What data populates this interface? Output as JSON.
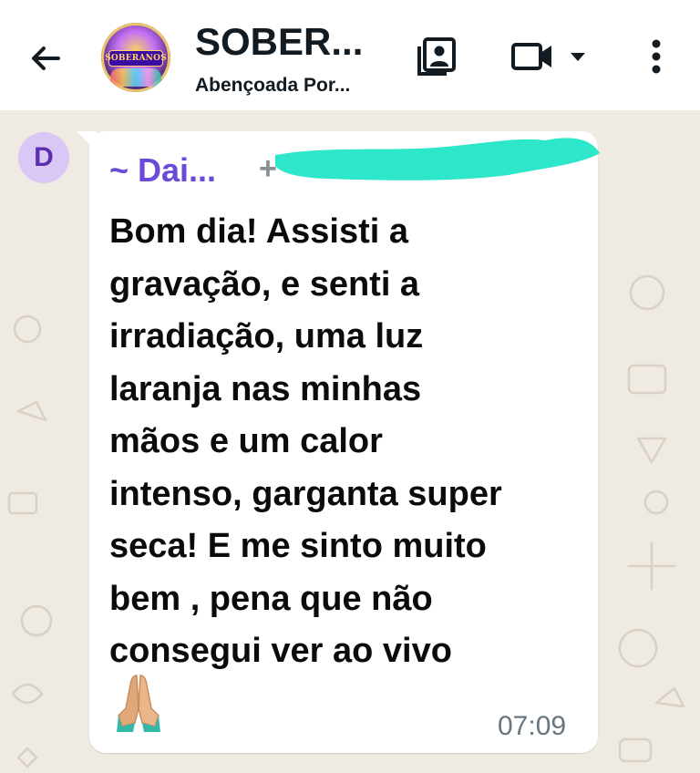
{
  "header": {
    "back_icon": "arrow-left-icon",
    "avatar_text": "SOBERANOS",
    "title": "SOBER...",
    "subtitle": "Abençoada Por...",
    "icons": [
      "contact-card-icon",
      "video-camera-icon",
      "caret-down-icon",
      "more-vert-icon"
    ]
  },
  "message": {
    "sender_initial": "D",
    "sender_name": "~ Dai...",
    "sender_phone": "+",
    "lines": [
      "Bom dia! Assisti a",
      "gravação, e senti a",
      "irradiação, uma luz",
      "laranja nas minhas",
      "mãos e um calor",
      "intenso, garganta super",
      "seca! E me sinto muito",
      "bem , pena que não",
      "consegui ver ao vivo"
    ],
    "emoji_icon": "folded-hands-icon",
    "time": "07:09"
  },
  "colors": {
    "chat_background": "#efeae2",
    "sender_name": "#6a4bd8",
    "redaction": "#2ee6c9",
    "time": "#667781"
  }
}
